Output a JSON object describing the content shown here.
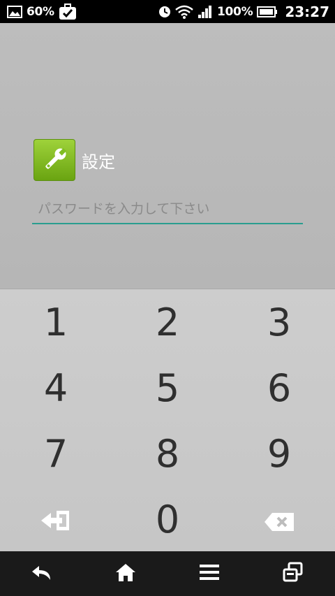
{
  "status_bar": {
    "battery_small": "60%",
    "battery_percent": "100%",
    "time": "23:27",
    "icons": [
      "image-icon",
      "briefcase-check-icon",
      "alarm-icon",
      "wifi-icon",
      "signal-icon",
      "battery-icon"
    ]
  },
  "header": {
    "title": "設定",
    "icon": "wrench-icon",
    "icon_color": "#7fbe22"
  },
  "password": {
    "placeholder": "パスワードを入力して下さい",
    "value": "",
    "underline_color": "#2a9d8f"
  },
  "keypad": {
    "keys": [
      "1",
      "2",
      "3",
      "4",
      "5",
      "6",
      "7",
      "8",
      "9",
      "0"
    ],
    "enter_icon": "enter-icon",
    "backspace_icon": "backspace-icon"
  },
  "nav_bar": {
    "icons": [
      "back-icon",
      "home-icon",
      "menu-icon",
      "recent-apps-icon"
    ]
  }
}
